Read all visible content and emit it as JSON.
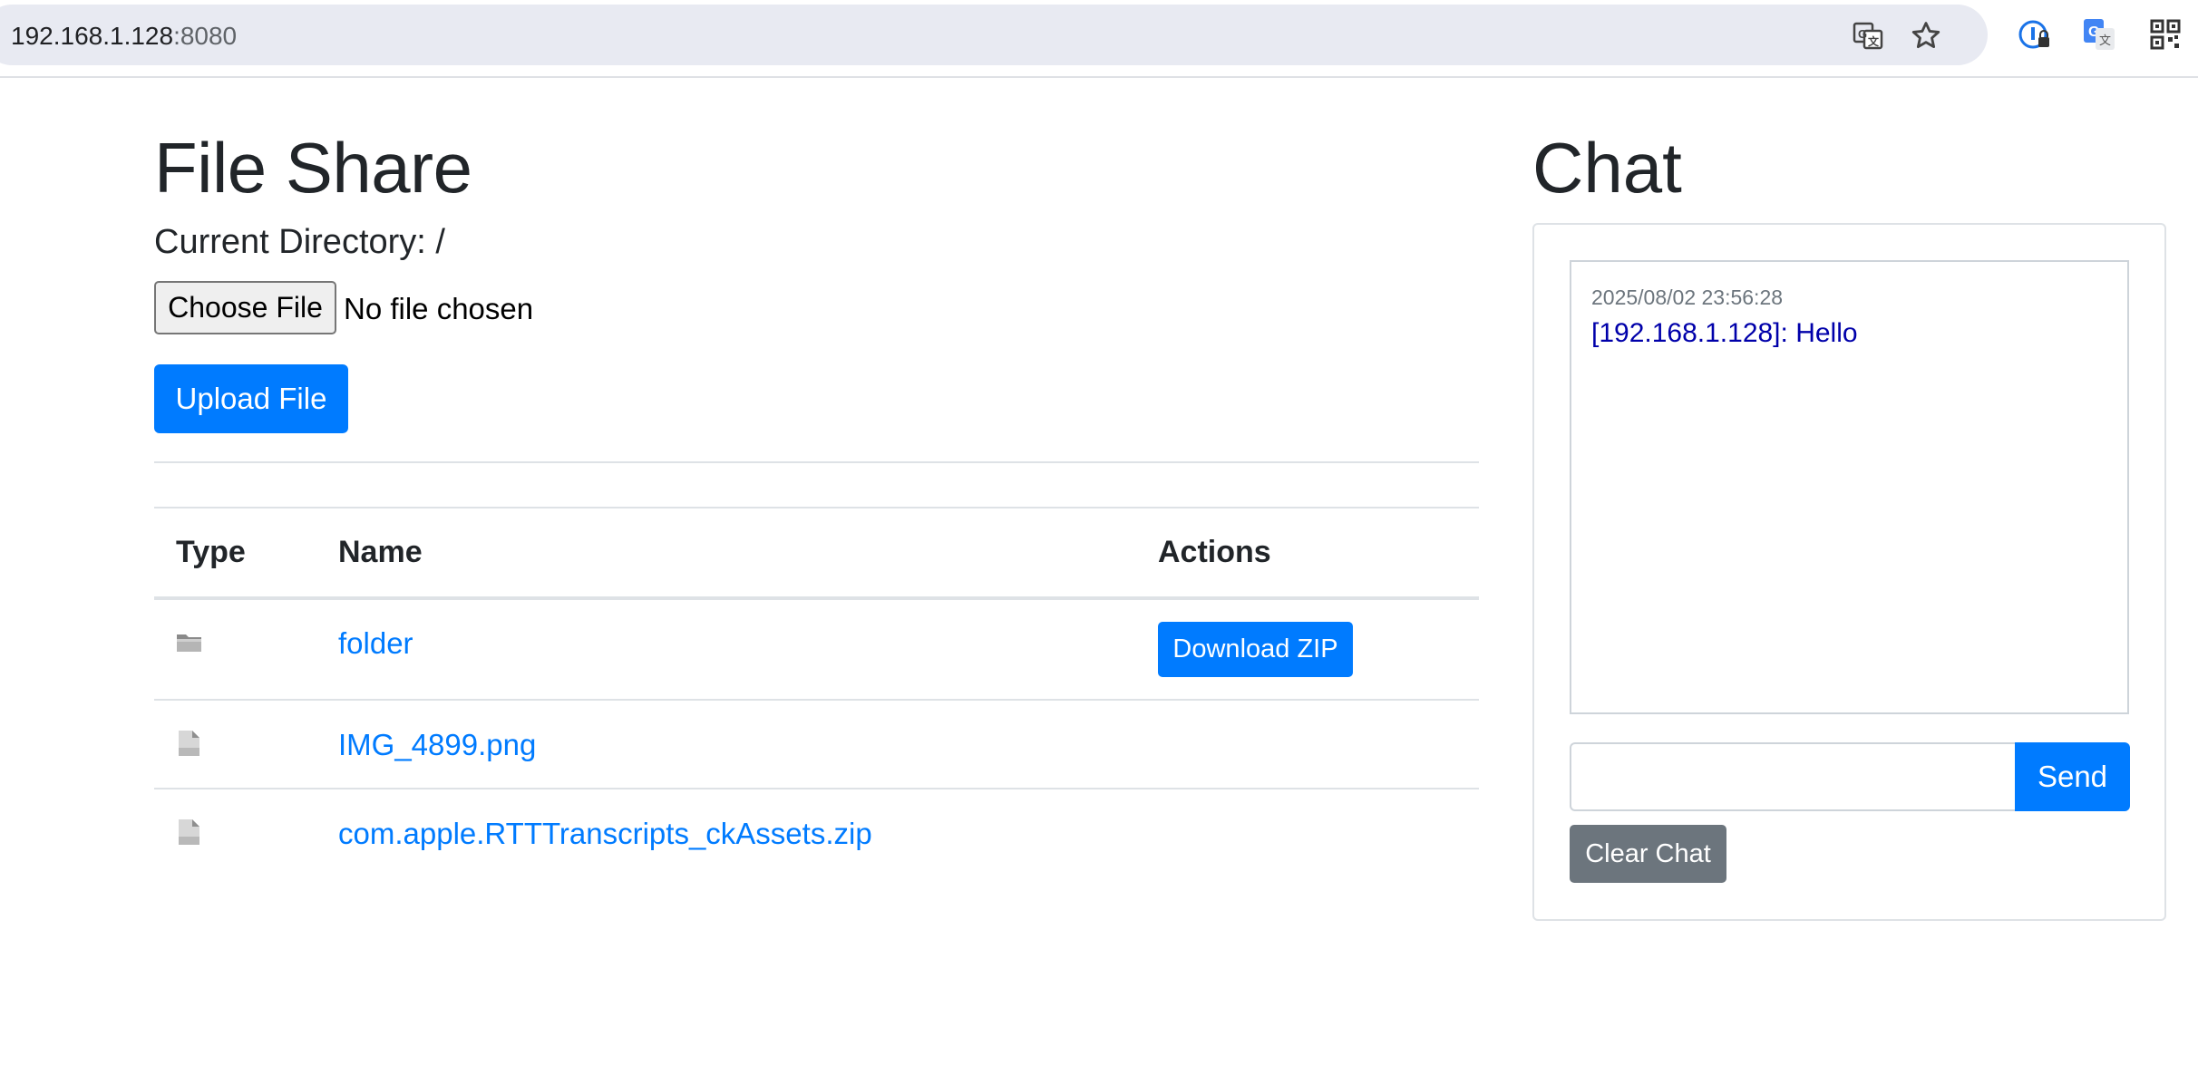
{
  "browser": {
    "url_host": "192.168.1.128",
    "url_port": ":8080",
    "icons": [
      "translate-icon",
      "bookmark-star-icon",
      "password-manager-icon",
      "google-translate-extension-icon",
      "qr-code-icon"
    ]
  },
  "file_share": {
    "title": "File Share",
    "current_directory": "Current Directory: /",
    "choose_file_label": "Choose File",
    "no_file_text": "No file chosen",
    "upload_label": "Upload File",
    "table": {
      "headers": [
        "Type",
        "Name",
        "Actions"
      ],
      "rows": [
        {
          "type_icon": "folder-icon",
          "name": "folder",
          "action": "Download ZIP"
        },
        {
          "type_icon": "file-icon",
          "name": "IMG_4899.png",
          "action": ""
        },
        {
          "type_icon": "file-icon",
          "name": "com.apple.RTTTranscripts_ckAssets.zip",
          "action": ""
        }
      ]
    }
  },
  "chat": {
    "title": "Chat",
    "messages": [
      {
        "timestamp": "2025/08/02 23:56:28",
        "text": "[192.168.1.128]: Hello"
      }
    ],
    "input_value": "",
    "send_label": "Send",
    "clear_label": "Clear Chat"
  },
  "colors": {
    "primary": "#007bff",
    "secondary": "#6c757d",
    "chat_message": "#0000aa"
  }
}
